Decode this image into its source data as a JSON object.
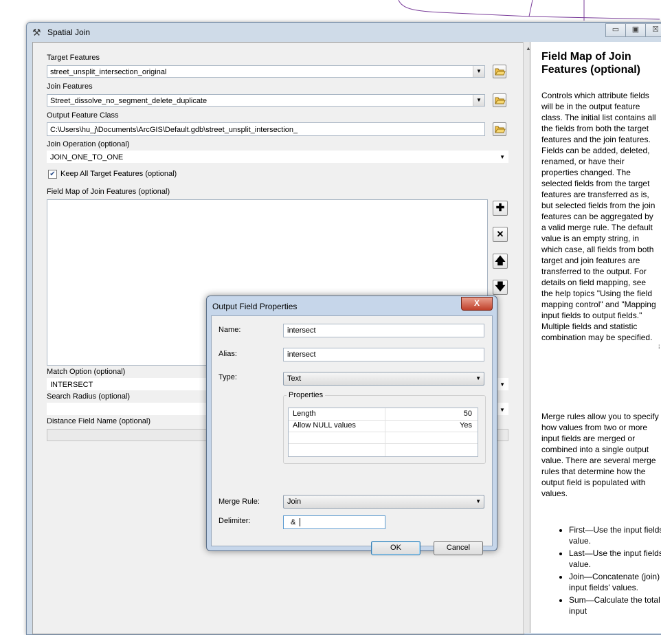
{
  "window": {
    "title": "Spatial Join",
    "controls": [
      "▭",
      "▣",
      "☒"
    ]
  },
  "form": {
    "target_features": {
      "label": "Target Features",
      "value": "street_unsplit_intersection_original"
    },
    "join_features": {
      "label": "Join Features",
      "value": "Street_dissolve_no_segment_delete_duplicate"
    },
    "output_feature_class": {
      "label": "Output Feature Class",
      "value": "C:\\Users\\hu_j\\Documents\\ArcGIS\\Default.gdb\\street_unsplit_intersection_"
    },
    "join_operation": {
      "label": "Join Operation (optional)",
      "value": "JOIN_ONE_TO_ONE"
    },
    "keep_all": {
      "label": "Keep All Target Features (optional)",
      "checked": true
    },
    "field_map": {
      "label": "Field Map of Join Features (optional)"
    },
    "match_option": {
      "label": "Match Option (optional)",
      "value": "INTERSECT"
    },
    "search_radius": {
      "label": "Search Radius (optional)",
      "value": ""
    },
    "distance_field": {
      "label": "Distance Field Name (optional)",
      "value": ""
    }
  },
  "help": {
    "title": "Field Map of Join Features (optional)",
    "para1": "Controls which attribute fields will be in the output feature class. The initial list contains all the fields from both the target features and the join features. Fields can be added, deleted, renamed, or have their properties changed. The selected fields from the target features are transferred as is, but selected fields from the join features can be aggregated by a valid merge rule. The default value is an empty string, in which case, all fields from both target and join features are transferred to the output. For details on field mapping, see the help topics \"Using the field mapping control\" and \"Mapping input fields to output fields.\" Multiple fields and statistic combination may be specified.",
    "para2": "Merge rules allow you to specify how values from two or more input fields are merged or combined into a single output value. There are several merge rules that determine how the output field is populated with values.",
    "bullets": [
      "First—Use the input fields' first value.",
      "Last—Use the input fields' last value.",
      "Join—Concatenate (join) the input fields' values.",
      "Sum—Calculate the total of the input"
    ]
  },
  "dialog": {
    "title": "Output Field Properties",
    "close": "X",
    "name_label": "Name:",
    "name_value": "intersect",
    "alias_label": "Alias:",
    "alias_value": "intersect",
    "type_label": "Type:",
    "type_value": "Text",
    "properties_title": "Properties",
    "properties": [
      {
        "key": "Length",
        "value": "50"
      },
      {
        "key": "Allow NULL values",
        "value": "Yes"
      }
    ],
    "merge_rule_label": "Merge Rule:",
    "merge_rule_value": "Join",
    "delimiter_label": "Delimiter:",
    "delimiter_value": "&",
    "ok": "OK",
    "cancel": "Cancel"
  }
}
